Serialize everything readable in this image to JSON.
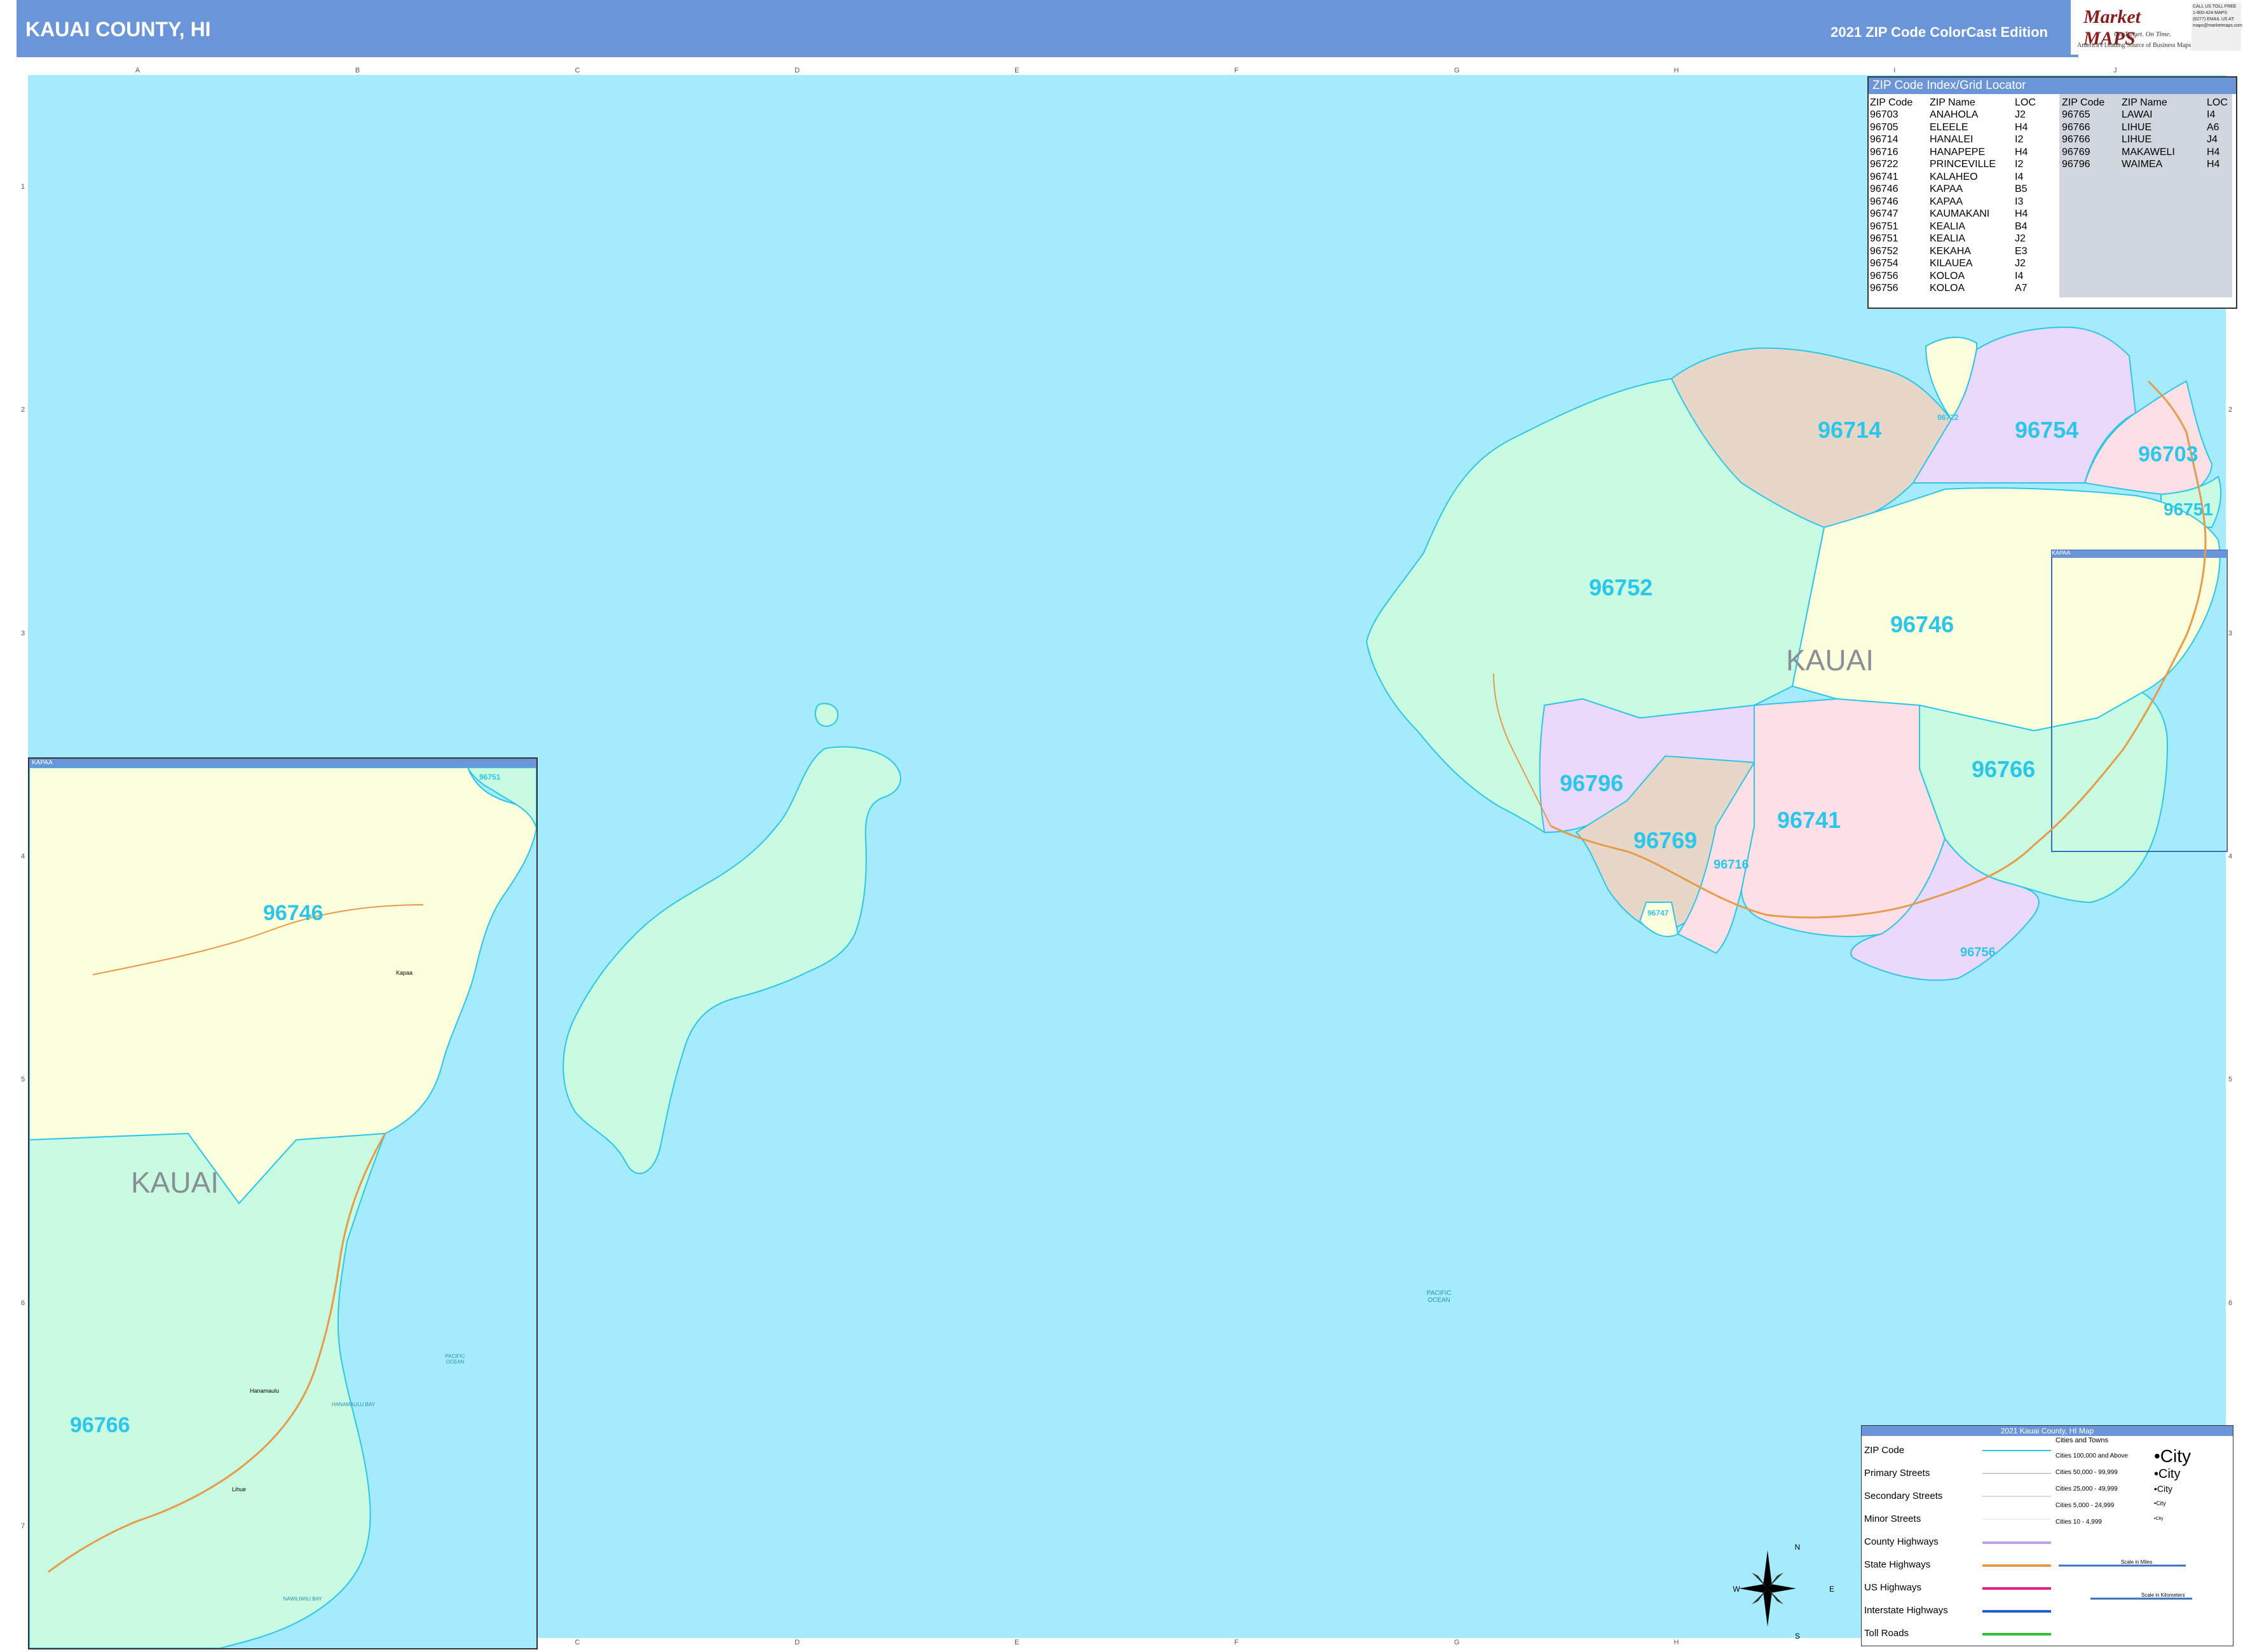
{
  "header": {
    "title": "KAUAI COUNTY, HI",
    "edition": "2021 ZIP Code ColorCast Edition"
  },
  "logo": {
    "brand": "Market MAPS",
    "tagline": "On Target. On Time.",
    "subtag": "America's Leading Source of Business Maps",
    "contact": "CALL US TOLL FREE 1-800-424-MAPS (6277) EMAIL US AT: maps@marketmaps.com"
  },
  "grid": {
    "columns": [
      "A",
      "B",
      "C",
      "D",
      "E",
      "F",
      "G",
      "H",
      "I",
      "J"
    ],
    "rows": [
      "1",
      "2",
      "3",
      "4",
      "5",
      "6",
      "7"
    ]
  },
  "zip_index": {
    "title": "ZIP Code Index/Grid Locator",
    "headers": {
      "zip": "ZIP Code",
      "name": "ZIP Name",
      "loc": "LOC"
    },
    "left": [
      {
        "zip": "96703",
        "name": "ANAHOLA",
        "loc": "J2"
      },
      {
        "zip": "96705",
        "name": "ELEELE",
        "loc": "H4"
      },
      {
        "zip": "96714",
        "name": "HANALEI",
        "loc": "I2"
      },
      {
        "zip": "96716",
        "name": "HANAPEPE",
        "loc": "H4"
      },
      {
        "zip": "96722",
        "name": "PRINCEVILLE",
        "loc": "I2"
      },
      {
        "zip": "96741",
        "name": "KALAHEO",
        "loc": "I4"
      },
      {
        "zip": "96746",
        "name": "KAPAA",
        "loc": "B5"
      },
      {
        "zip": "96746",
        "name": "KAPAA",
        "loc": "I3"
      },
      {
        "zip": "96747",
        "name": "KAUMAKANI",
        "loc": "H4"
      },
      {
        "zip": "96751",
        "name": "KEALIA",
        "loc": "B4"
      },
      {
        "zip": "96751",
        "name": "KEALIA",
        "loc": "J2"
      },
      {
        "zip": "96752",
        "name": "KEKAHA",
        "loc": "E3"
      },
      {
        "zip": "96754",
        "name": "KILAUEA",
        "loc": "J2"
      },
      {
        "zip": "96756",
        "name": "KOLOA",
        "loc": "I4"
      },
      {
        "zip": "96756",
        "name": "KOLOA",
        "loc": "A7"
      }
    ],
    "right": [
      {
        "zip": "96765",
        "name": "LAWAI",
        "loc": "I4"
      },
      {
        "zip": "96766",
        "name": "LIHUE",
        "loc": "A6"
      },
      {
        "zip": "96766",
        "name": "LIHUE",
        "loc": "J4"
      },
      {
        "zip": "96769",
        "name": "MAKAWELI",
        "loc": "H4"
      },
      {
        "zip": "96796",
        "name": "WAIMEA",
        "loc": "H4"
      }
    ]
  },
  "map_labels": {
    "county": "KAUAI",
    "ocean": "PACIFIC OCEAN",
    "inset_title": "KAPAA",
    "zips": {
      "z96714": "96714",
      "z96754": "96754",
      "z96703": "96703",
      "z96751": "96751",
      "z96752": "96752",
      "z96746": "96746",
      "z96766": "96766",
      "z96796": "96796",
      "z96741": "96741",
      "z96769": "96769",
      "z96716": "96716",
      "z96756": "96756",
      "z96722": "96722",
      "z96747": "96747"
    },
    "inset_zips": {
      "z96746": "96746",
      "z96766": "96766",
      "z96751": "96751"
    },
    "inset_places": {
      "kapaa": "Kapaa",
      "lihue": "Lihue",
      "hanamaulu": "Hanamaulu",
      "hanamaulu_bay": "HANAMAULU BAY",
      "nawiliwili_bay": "NAWILIWILI BAY",
      "ocean": "PACIFIC OCEAN"
    }
  },
  "legend": {
    "title": "2021 Kauai County, HI Map",
    "items": [
      "ZIP Code",
      "Primary Streets",
      "Secondary Streets",
      "Minor Streets",
      "County Highways",
      "State Highways",
      "US Highways",
      "Interstate Highways",
      "Toll Roads"
    ],
    "cities_header": "Cities and Towns",
    "cities": [
      {
        "range": "Cities 100,000 and Above",
        "sample": "City"
      },
      {
        "range": "Cities 50,000 - 99,999",
        "sample": "City"
      },
      {
        "range": "Cities 25,000 - 49,999",
        "sample": "City"
      },
      {
        "range": "Cities 5,000 - 24,999",
        "sample": "City"
      },
      {
        "range": "Cities 10 - 4,999",
        "sample": "City"
      }
    ],
    "scale_miles": "Scale in Miles",
    "scale_km": "Scale in Kilometers"
  },
  "compass": {
    "n": "N",
    "s": "S",
    "e": "E",
    "w": "W"
  },
  "colors": {
    "ocean": "#a5ebfc",
    "header": "#6a95d8",
    "zip_label": "#2bc6ea",
    "z96752": "#c9fbe2",
    "z96714": "#e6d7c8",
    "z96754": "#ead9fb",
    "z96703": "#fde0e6",
    "z96746": "#fdfedb",
    "z96766": "#c9fbe2",
    "z96796": "#ead9fb",
    "z96741": "#fde0e6",
    "z96769": "#e6d7c8"
  }
}
